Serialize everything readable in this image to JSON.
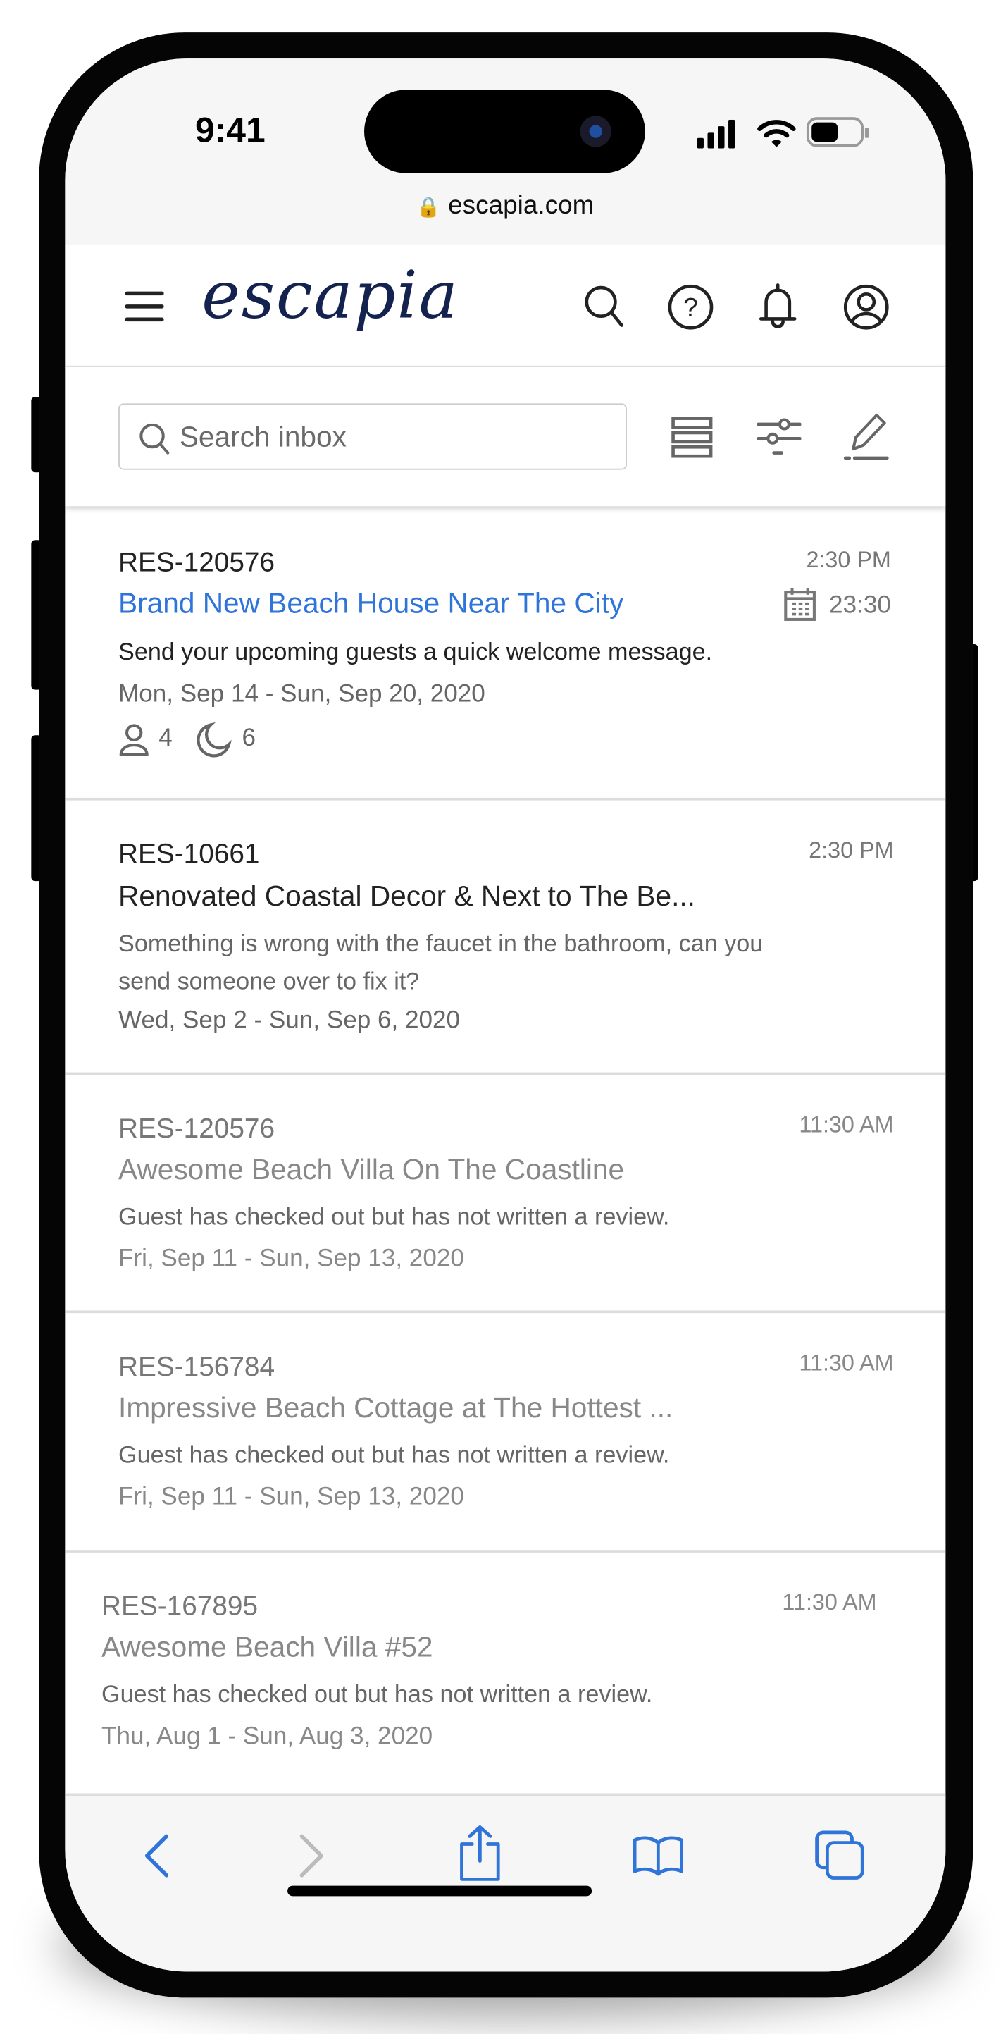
{
  "status_bar": {
    "time": "9:41",
    "url": "escapia.com"
  },
  "header": {
    "logo": "escapia",
    "icons": [
      "menu-icon",
      "search-icon",
      "help-icon",
      "bell-icon",
      "account-icon"
    ]
  },
  "toolbar": {
    "search_placeholder": "Search inbox",
    "icons": [
      "list-view-icon",
      "filter-icon",
      "compose-icon"
    ]
  },
  "accent_color": "#2f74d8",
  "messages": [
    {
      "res_id": "RES-120576",
      "title": "Brand New Beach House Near The City",
      "message": "Send your upcoming guests a quick welcome message.",
      "dates": "Mon, Sep 14 - Sun, Sep 20, 2020",
      "time": "2:30 PM",
      "scheduled": "23:30",
      "guests": "4",
      "nights": "6",
      "state": "highlighted"
    },
    {
      "res_id": "RES-10661",
      "title": "Renovated Coastal Decor & Next to The Be...",
      "message": "Something is wrong with the faucet in the bathroom, can you send someone over to fix it?",
      "dates": "Wed, Sep 2 - Sun, Sep 6, 2020",
      "time": "2:30 PM",
      "state": "unread"
    },
    {
      "res_id": "RES-120576",
      "title": "Awesome Beach Villa On The Coastline",
      "message": "Guest has checked out but has not written a review.",
      "dates": "Fri, Sep 11 - Sun, Sep 13, 2020",
      "time": "11:30 AM",
      "state": "read"
    },
    {
      "res_id": "RES-156784",
      "title": "Impressive Beach Cottage at The Hottest ...",
      "message": "Guest has checked out but has not written a review.",
      "dates": "Fri, Sep 11 - Sun, Sep 13, 2020",
      "time": "11:30 AM",
      "state": "read"
    },
    {
      "res_id": "RES-167895",
      "title": "Awesome Beach Villa #52",
      "message": "Guest has checked out but has not written a review.",
      "dates": "Thu, Aug 1 - Sun, Aug 3, 2020",
      "time": "11:30 AM",
      "state": "read"
    }
  ],
  "browser_bar": {
    "icons": [
      "back-icon",
      "forward-icon",
      "share-icon",
      "bookmarks-icon",
      "tabs-icon"
    ]
  }
}
